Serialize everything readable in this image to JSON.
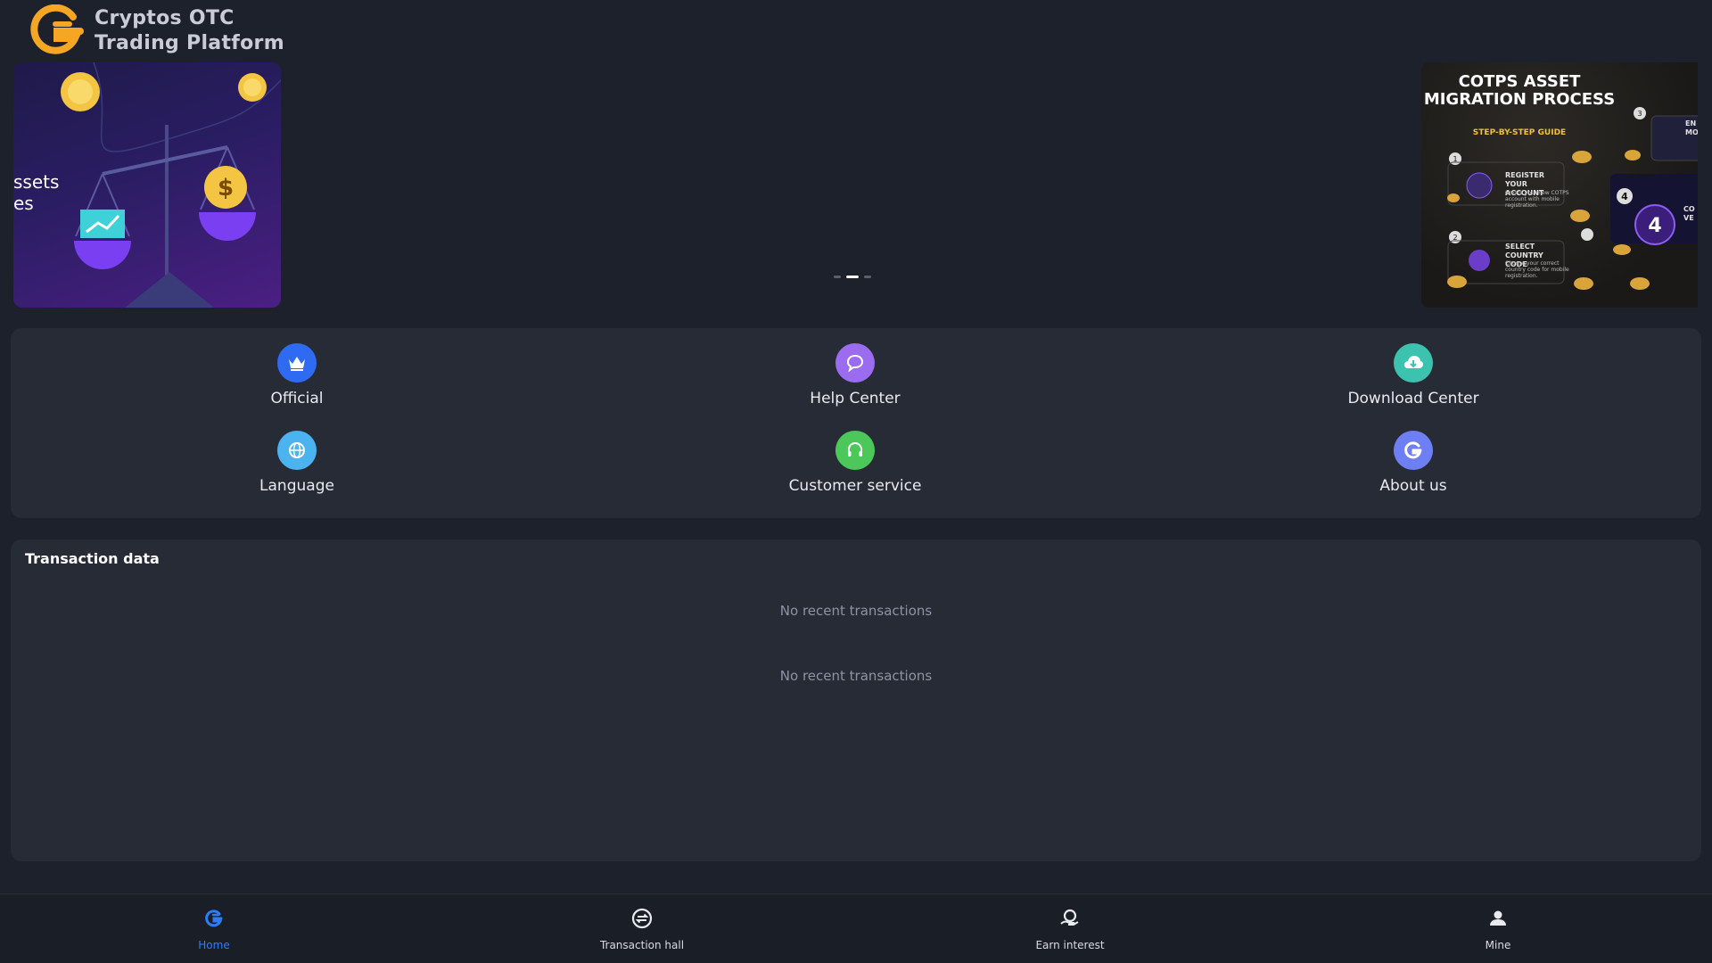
{
  "header": {
    "logo_line1": "Cryptos OTC",
    "logo_line2": "Trading Platform"
  },
  "banner": {
    "left_slide_text_line1": "ssets",
    "left_slide_text_line2": "es",
    "right_slide_title": "COTPS ASSET MIGRATION PROCESS",
    "right_slide_subtitle": "STEP-BY-STEP GUIDE",
    "right_slide_steps": [
      {
        "num": "1",
        "title": "REGISTER YOUR ACCOUNT",
        "desc": "Create your new COTPS account with mobile registration."
      },
      {
        "num": "2",
        "title": "SELECT COUNTRY CODE",
        "desc": "Choose your correct country code for mobile registration."
      },
      {
        "num": "3",
        "title": "EN MO",
        "desc": ""
      },
      {
        "num": "4",
        "title": "CO VE",
        "desc": ""
      }
    ],
    "active_dot": 1
  },
  "menu": {
    "items": [
      {
        "label": "Official",
        "icon": "crown-icon",
        "color": "#2f6bf2"
      },
      {
        "label": "Help Center",
        "icon": "chat-bubble-icon",
        "color": "#9b6cf0"
      },
      {
        "label": "Download Center",
        "icon": "cloud-download-icon",
        "color": "#3cc3b0"
      },
      {
        "label": "Language",
        "icon": "globe-icon",
        "color": "#4bb3f0"
      },
      {
        "label": "Customer service",
        "icon": "headset-icon",
        "color": "#4cc85b"
      },
      {
        "label": "About us",
        "icon": "logo-g-icon",
        "color": "#6e7ff3"
      }
    ]
  },
  "transactions": {
    "title": "Transaction data",
    "empty_text_1": "No recent transactions",
    "empty_text_2": "No recent transactions"
  },
  "nav": {
    "items": [
      {
        "label": "Home",
        "icon": "home-logo-icon",
        "active": true
      },
      {
        "label": "Transaction hall",
        "icon": "exchange-icon",
        "active": false
      },
      {
        "label": "Earn interest",
        "icon": "earn-icon",
        "active": false
      },
      {
        "label": "Mine",
        "icon": "user-icon",
        "active": false
      }
    ],
    "active_color": "#2f7cf6"
  }
}
